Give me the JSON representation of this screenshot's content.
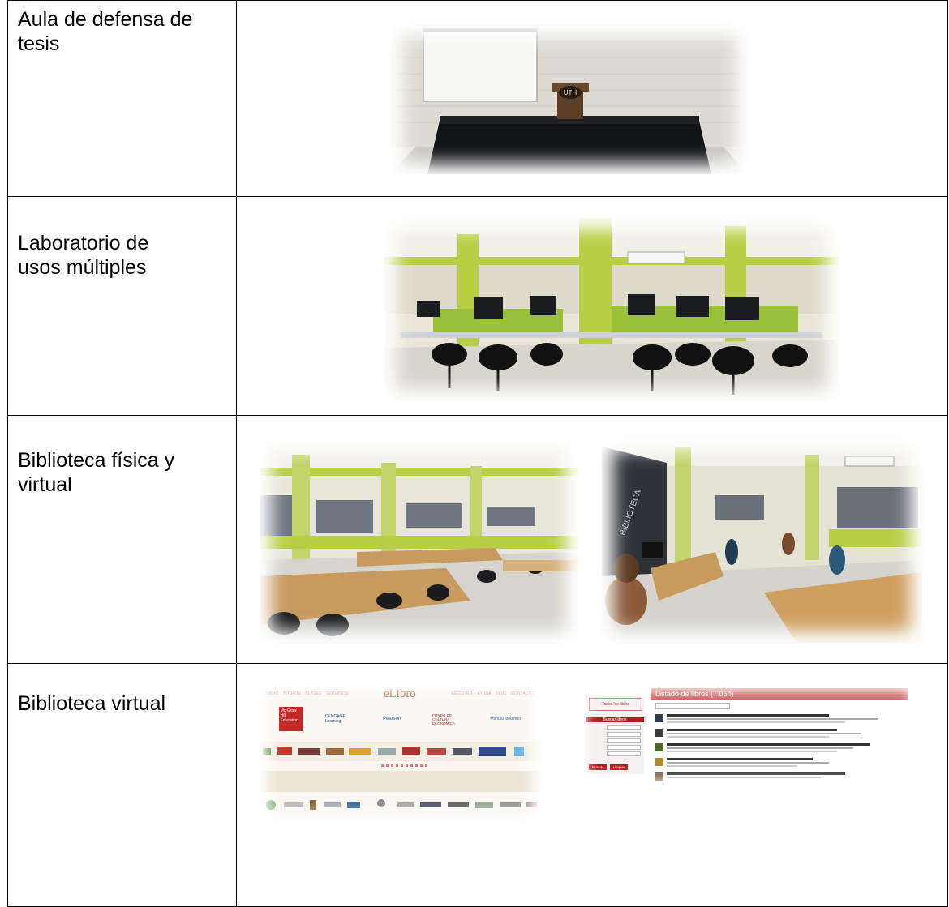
{
  "rows": [
    {
      "label": "Aula de defensa de\ntesis",
      "image": "thesis-defense-room-photo",
      "podium_logo": "UTH"
    },
    {
      "label": "Laboratorio de\nusos múltiples",
      "image": "multipurpose-computer-lab-photo"
    },
    {
      "label": "Biblioteca física y\nvirtual",
      "images": [
        "physical-library-photo",
        "library-students-photo"
      ],
      "wall_sign": "BIBLIOTECA"
    },
    {
      "label": "Biblioteca virtual",
      "images": [
        "elibro-portal-screenshot",
        "book-listing-screenshot"
      ]
    }
  ],
  "elibro": {
    "brand": "eLibro",
    "nav_left": [
      "INICIO",
      "TITULOS",
      "CLASES",
      "SERVICIOS"
    ],
    "nav_right": [
      "REGISTRO",
      "AYUDA",
      "PLUS",
      "CONTACTO"
    ],
    "publishers": [
      "Mc Graw Hill Education",
      "CENGAGE Learning",
      "Pearson",
      "FONDO DE CULTURA ECONÓMICA",
      "Manual Moderno"
    ]
  },
  "catalog": {
    "title": "Listado de libros (7.064)",
    "search_heading": "Buscar libros",
    "left_box": "Todos los libros",
    "button_search": "Buscar",
    "button_clear": "Limpiar"
  },
  "colors": {
    "wall_green": "#b8cf45",
    "elibro_red": "#c0392b",
    "catalog_red": "#b71c1c"
  }
}
